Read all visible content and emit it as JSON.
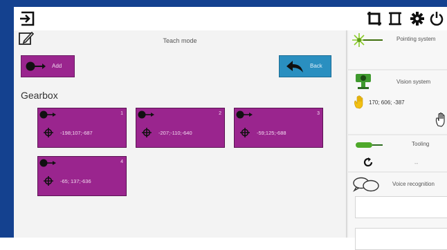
{
  "teach": {
    "title": "Teach mode",
    "add_label": "Add",
    "back_label": "Back",
    "group_title": "Gearbox",
    "tiles": [
      {
        "num": "1",
        "coord": "-198;107;-687"
      },
      {
        "num": "2",
        "coord": "-207;-110;-640"
      },
      {
        "num": "3",
        "coord": "-59;125;-688"
      },
      {
        "num": "4",
        "coord": "-65; 137;-636"
      }
    ]
  },
  "side": {
    "pointing_title": "Pointing system",
    "vision_title": "Vision system",
    "vision_coord": "170; 606; -387",
    "tooling_title": "Tooling",
    "tooling_value": "--",
    "voice_title": "Voice recognition"
  },
  "colors": {
    "tile": "#9a258e",
    "back_button": "#2a8fc0",
    "frame": "#14418f"
  }
}
